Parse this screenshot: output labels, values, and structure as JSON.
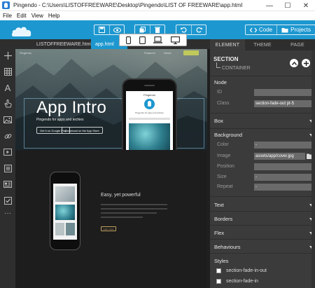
{
  "window": {
    "title": "Pingendo - C:\\Users\\LISTOFFREEWARE\\Desktop\\Pingendo\\LIST OF FREEWARE\\app.html",
    "minimize_glyph": "—",
    "maximize_glyph": "☐",
    "close_glyph": "✕"
  },
  "menu": [
    "File",
    "Edit",
    "View",
    "Help"
  ],
  "toolbar": {
    "code_label": "Code",
    "projects_label": "Projects",
    "accent_color": "#1d97cf"
  },
  "tabs": [
    {
      "label": "LISTOFFREEWARE.html",
      "close": "✖",
      "active": false
    },
    {
      "label": "app.html",
      "close": "✖",
      "active": true
    }
  ],
  "canvas": {
    "hero": {
      "brand": "Pingendo",
      "nav_links": [
        "Features",
        "About"
      ],
      "title": "App Intro",
      "subtitle": "Pingendo for apps and techies",
      "google_play": "Get it on Google Play",
      "app_store": "Download on the App Store"
    },
    "phone": {
      "app_name": "Pingendo",
      "tagline": "Pingendo for apps and techies"
    },
    "section2": {
      "heading": "Easy, yet powerful",
      "button": "Learn more"
    }
  },
  "panel": {
    "tabs": [
      "ELEMENT",
      "THEME",
      "PAGE"
    ],
    "active_tab": "ELEMENT",
    "element_name": "SECTION",
    "parent_label": "CONTAINER",
    "node": {
      "title": "Node",
      "id_label": "ID",
      "id_value": "",
      "class_label": "Class",
      "class_value": "section-fade-out pt-5"
    },
    "box_label": "Box",
    "background": {
      "title": "Background",
      "color_label": "Color",
      "color_value": "-",
      "image_label": "Image",
      "image_value": "assets/app/cover.jpg",
      "position_label": "Position",
      "position_value": "",
      "size_label": "Size",
      "size_value": "-",
      "repeat_label": "Repeat",
      "repeat_value": "-"
    },
    "collapsed_sections": [
      "Text",
      "Borders",
      "Flex",
      "Behaviours"
    ],
    "styles": {
      "title": "Styles",
      "items": [
        "section-fade-in-out",
        "section-fade-in"
      ]
    }
  }
}
